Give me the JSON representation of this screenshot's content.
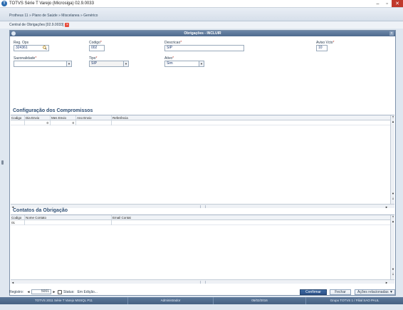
{
  "window": {
    "title": "TOTVS Série T Varejo (Microsiga) 02.9.0033",
    "controls": [
      "minimize",
      "maximize",
      "close"
    ]
  },
  "breadcrumb": "Protheus 11 » Plano de Saúde » Miscelanea » Genérico",
  "document_tab": "Central de Obrigações [02.9.0033]",
  "dialog": {
    "title": "Obrigações - INCLUIR",
    "fields": {
      "reg_ops": {
        "label": "Reg. Ops",
        "value": "324361"
      },
      "codigo": {
        "label": "Codigo",
        "value": "002"
      },
      "descricao": {
        "label": "Descricao",
        "value": "SIP"
      },
      "aviso_vcto": {
        "label": "Aviso Vcto",
        "value": "10"
      },
      "sazonalidade": {
        "label": "Sazonalidade",
        "value": ""
      },
      "tipo": {
        "label": "Tipo",
        "value": "SIP"
      },
      "ativo": {
        "label": "Ativo",
        "value": "Sim"
      }
    },
    "compromissos": {
      "title": "Configuração dos Compromissos",
      "columns": [
        "Codigo",
        "Dia Envio",
        "Mes Envio",
        "Ano Envio",
        "Referência"
      ],
      "rows": [
        [
          "",
          "0",
          "0",
          "",
          ""
        ]
      ]
    },
    "contatos": {
      "title": "Contatos da Obrigação",
      "columns": [
        "Codigo",
        "Nome Contato",
        "Email Contat"
      ],
      "rows": [
        [
          "01",
          "",
          ""
        ]
      ]
    }
  },
  "footer": {
    "registro_label": "Registro:",
    "registro_value": "5001",
    "status_label": "Status:",
    "status_value": "Em Edição...",
    "buttons": {
      "confirmar": "Confirmar",
      "fechar": "Fechar",
      "acoes": "Ações relacionadas"
    }
  },
  "statusbar": [
    "TOTVS 2011 Série T Varejo MSSQL P11",
    "Administrador",
    "05/02/2016",
    "Grupo TOTVS 1 / Filial SAO PAUL"
  ],
  "colors": {
    "accent": "#2b5189",
    "dialog_header": "#5a7699",
    "required": "#c0392b"
  }
}
